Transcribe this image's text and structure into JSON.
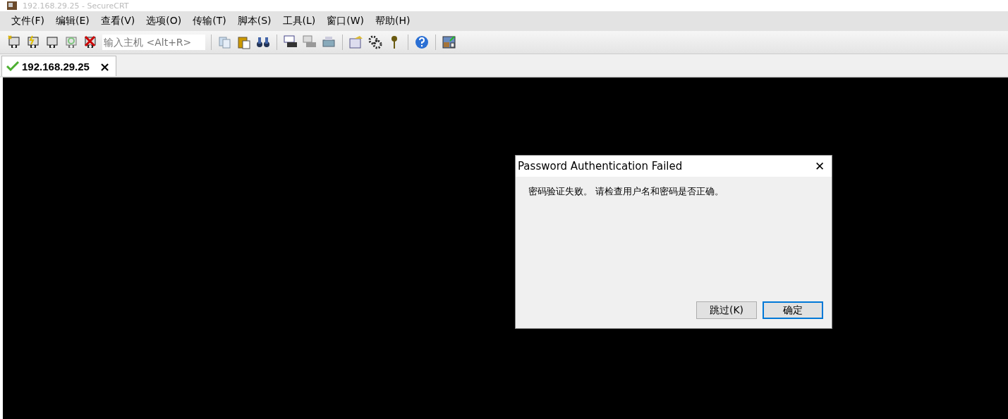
{
  "window": {
    "title": "192.168.29.25 - SecureCRT"
  },
  "menu": [
    "文件(F)",
    "编辑(E)",
    "查看(V)",
    "选项(O)",
    "传输(T)",
    "脚本(S)",
    "工具(L)",
    "窗口(W)",
    "帮助(H)"
  ],
  "toolbar": {
    "host_field": {
      "placeholder": "输入主机 <Alt+R>"
    }
  },
  "tabs": [
    {
      "label": "192.168.29.25",
      "selected": true,
      "connected": true,
      "close": "×"
    }
  ],
  "dialog": {
    "title": "Password Authentication Failed",
    "close": "✕",
    "message": "密码验证失败。 请检查用户名和密码是否正确。",
    "buttons": [
      {
        "label": "跳过(K)",
        "default": false
      },
      {
        "label": "确定",
        "default": true
      }
    ]
  }
}
